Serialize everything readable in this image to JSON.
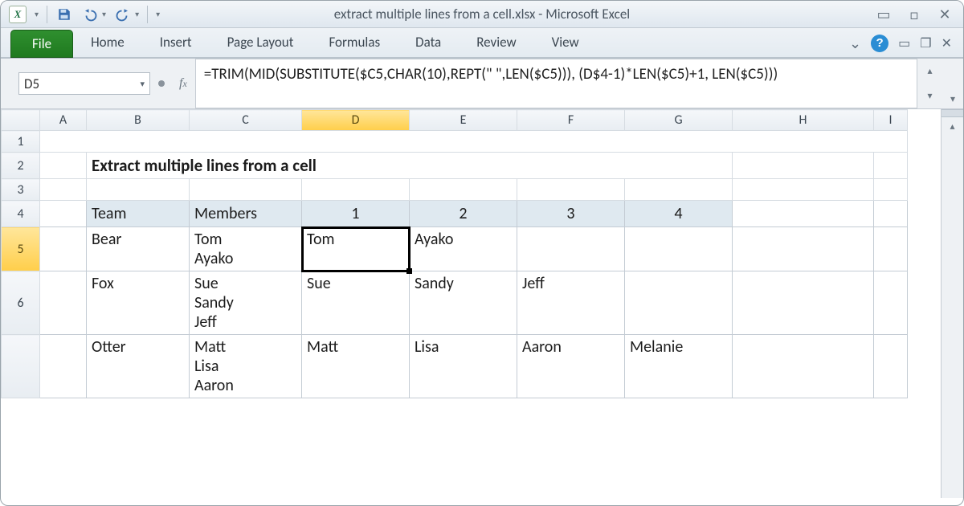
{
  "title": "extract multiple lines from a cell.xlsx  -  Microsoft Excel",
  "ribbon": {
    "file": "File",
    "tabs": [
      "Home",
      "Insert",
      "Page Layout",
      "Formulas",
      "Data",
      "Review",
      "View"
    ]
  },
  "namebox": "D5",
  "formula": "=TRIM(MID(SUBSTITUTE($C5,CHAR(10),REPT(\" \",LEN($C5))), (D$4-1)*LEN($C5)+1, LEN($C5)))",
  "columns": [
    "A",
    "B",
    "C",
    "D",
    "E",
    "F",
    "G",
    "H",
    "I"
  ],
  "active_col": "D",
  "rowheaders": [
    "1",
    "2",
    "3",
    "4",
    "5",
    "6"
  ],
  "active_row": "5",
  "cells": {
    "B2": "Extract multiple lines from a cell",
    "B4": "Team",
    "C4": "Members",
    "D4": "1",
    "E4": "2",
    "F4": "3",
    "G4": "4",
    "B5": "Bear",
    "C5": "Tom\nAyako",
    "D5": "Tom",
    "E5": "Ayako",
    "B6": "Fox",
    "C6": "Sue\nSandy\nJeff",
    "D6": "Sue",
    "E6": "Sandy",
    "F6": "Jeff",
    "B7": "Otter",
    "C7": "Matt\nLisa\nAaron",
    "D7": "Matt",
    "E7": "Lisa",
    "F7": "Aaron",
    "G7": "Melanie"
  }
}
